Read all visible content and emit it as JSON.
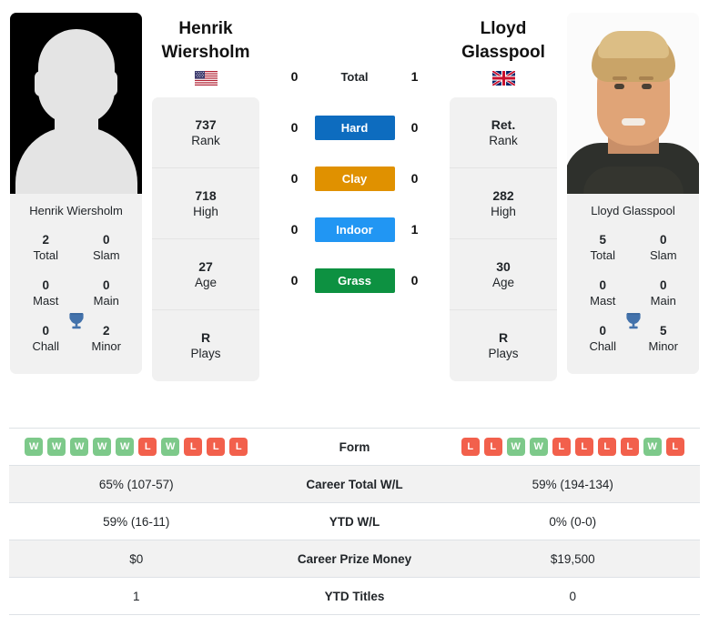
{
  "players": {
    "left": {
      "first_name": "Henrik",
      "last_name": "Wiersholm",
      "full_name": "Henrik Wiersholm",
      "country": "USA",
      "flag": "us-flag-icon",
      "photo": "player-photo-placeholder",
      "stats": [
        {
          "value": "737",
          "label": "Rank"
        },
        {
          "value": "718",
          "label": "High"
        },
        {
          "value": "27",
          "label": "Age"
        },
        {
          "value": "R",
          "label": "Plays"
        }
      ],
      "titles": [
        {
          "value": "2",
          "label": "Total"
        },
        {
          "value": "0",
          "label": "Slam"
        },
        {
          "value": "0",
          "label": "Mast"
        },
        {
          "value": "0",
          "label": "Main"
        },
        {
          "value": "0",
          "label": "Chall"
        },
        {
          "value": "2",
          "label": "Minor"
        }
      ],
      "form": [
        "W",
        "W",
        "W",
        "W",
        "W",
        "L",
        "W",
        "L",
        "L",
        "L"
      ],
      "career_total_wl": "65% (107-57)",
      "ytd_wl": "59% (16-11)",
      "career_prize_money": "$0",
      "ytd_titles": "1"
    },
    "right": {
      "first_name": "Lloyd",
      "last_name": "Glasspool",
      "full_name": "Lloyd Glasspool",
      "country": "GBR",
      "flag": "gb-flag-icon",
      "photo": "player-photo",
      "stats": [
        {
          "value": "Ret.",
          "label": "Rank"
        },
        {
          "value": "282",
          "label": "High"
        },
        {
          "value": "30",
          "label": "Age"
        },
        {
          "value": "R",
          "label": "Plays"
        }
      ],
      "titles": [
        {
          "value": "5",
          "label": "Total"
        },
        {
          "value": "0",
          "label": "Slam"
        },
        {
          "value": "0",
          "label": "Mast"
        },
        {
          "value": "0",
          "label": "Main"
        },
        {
          "value": "0",
          "label": "Chall"
        },
        {
          "value": "5",
          "label": "Minor"
        }
      ],
      "form": [
        "L",
        "L",
        "W",
        "W",
        "L",
        "L",
        "L",
        "L",
        "W",
        "L"
      ],
      "career_total_wl": "59% (194-134)",
      "ytd_wl": "0% (0-0)",
      "career_prize_money": "$19,500",
      "ytd_titles": "0"
    }
  },
  "head_to_head": [
    {
      "surface": "Total",
      "left": "0",
      "right": "1",
      "color": "none"
    },
    {
      "surface": "Hard",
      "left": "0",
      "right": "0",
      "color": "#0d6cbf"
    },
    {
      "surface": "Clay",
      "left": "0",
      "right": "0",
      "color": "#e09100"
    },
    {
      "surface": "Indoor",
      "left": "0",
      "right": "1",
      "color": "#2196f3"
    },
    {
      "surface": "Grass",
      "left": "0",
      "right": "0",
      "color": "#0d9141"
    }
  ],
  "table": {
    "rows": [
      {
        "label": "Form",
        "type": "form"
      },
      {
        "label": "Career Total W/L",
        "type": "text",
        "key": "career_total_wl"
      },
      {
        "label": "YTD W/L",
        "type": "text",
        "key": "ytd_wl"
      },
      {
        "label": "Career Prize Money",
        "type": "text",
        "key": "career_prize_money"
      },
      {
        "label": "YTD Titles",
        "type": "text",
        "key": "ytd_titles"
      }
    ]
  },
  "colors": {
    "win": "#7dc98a",
    "loss": "#f2604c",
    "trophy": "#4372ab",
    "card_bg": "#f1f1f1",
    "stripe": "#f2f2f2"
  },
  "icons": {
    "trophy": "trophy-icon"
  }
}
